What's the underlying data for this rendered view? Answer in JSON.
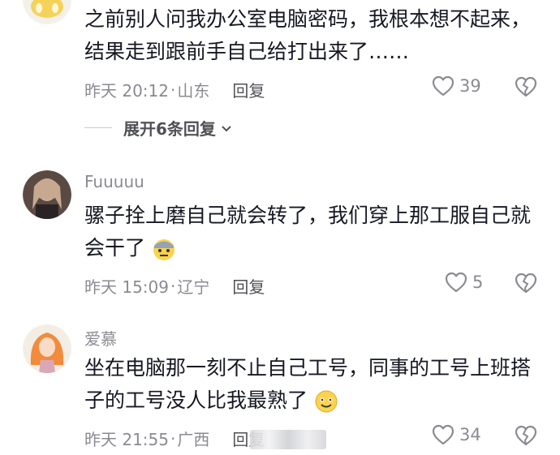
{
  "comments": [
    {
      "username": "",
      "text_lines": [
        "之前别人问我办公室电脑密码，我根本想不起来，",
        "结果走到跟前手自己给打出来了……"
      ],
      "time": "昨天 20:12",
      "location": "山东",
      "reply_label": "回复",
      "likes": "39",
      "expand_label": "展开6条回复"
    },
    {
      "username": "Fuuuuu",
      "text_lines": [
        "骡子拴上磨自己就会转了，我们穿上那工服自己就",
        "会干了"
      ],
      "time": "昨天 15:09",
      "location": "辽宁",
      "reply_label": "回复",
      "likes": "5"
    },
    {
      "username": "爱慕",
      "text_lines": [
        "坐在电脑那一刻不止自己工号，同事的工号上班搭",
        "子的工号没人比我最熟了"
      ],
      "time": "昨天 21:55",
      "location": "广西",
      "reply_label": "回复",
      "likes": "34"
    }
  ],
  "separator": "·",
  "icons": {
    "like": "heart-outline-icon",
    "dislike": "broken-heart-icon",
    "expand": "chevron-down-icon",
    "emoji_2": "dizzy-face-emoji-icon",
    "emoji_3": "smiling-face-emoji-icon"
  },
  "colors": {
    "text": "#161823",
    "meta": "#8a8b91",
    "reply": "#505156"
  }
}
